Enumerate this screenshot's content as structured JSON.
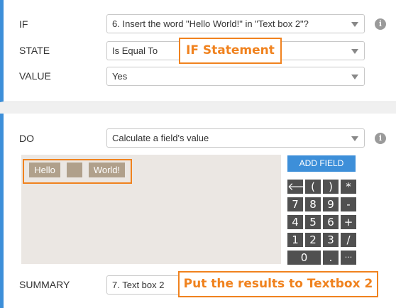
{
  "if_section": {
    "if_label": "IF",
    "if_value": "6. Insert the word \"Hello World!\" in \"Text box 2\"?",
    "state_label": "STATE",
    "state_value": "Is Equal To",
    "value_label": "VALUE",
    "value_value": "Yes",
    "info_icon": "i",
    "callout": "IF Statement"
  },
  "do_section": {
    "do_label": "DO",
    "do_value": "Calculate a field's value",
    "info_icon": "i",
    "tokens": [
      "Hello",
      "",
      "World!"
    ],
    "add_field_label": "ADD FIELD",
    "keypad": [
      "🡐",
      "(",
      ")",
      "*",
      "7",
      "8",
      "9",
      "-",
      "4",
      "5",
      "6",
      "+",
      "1",
      "2",
      "3",
      "/",
      "0",
      ".",
      "···"
    ],
    "summary_label": "SUMMARY",
    "summary_value": "7. Text box 2",
    "callout": "Put the results to Textbox 2"
  },
  "colors": {
    "accent": "#3d8fd9",
    "callout": "#f0821e",
    "token": "#b0a08b",
    "key": "#505050"
  }
}
